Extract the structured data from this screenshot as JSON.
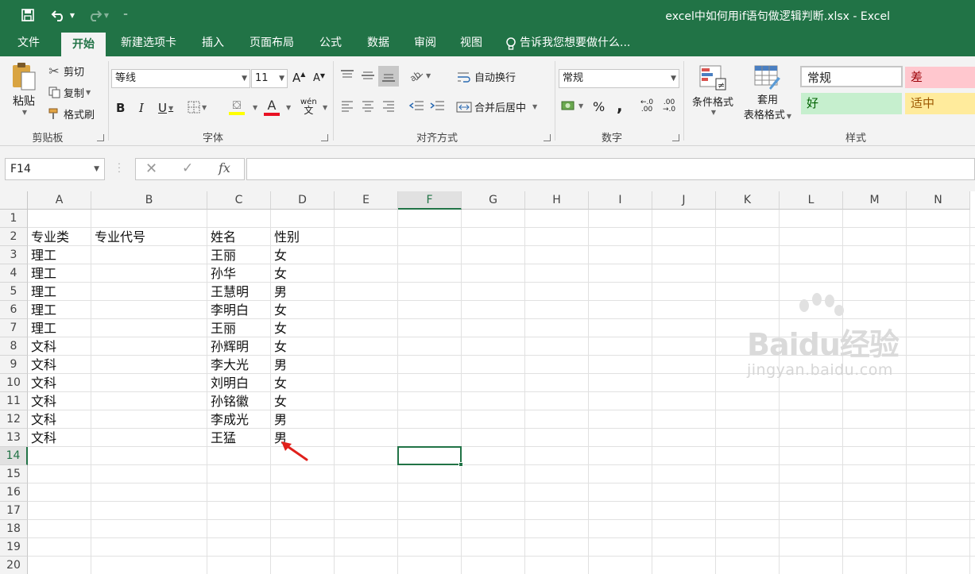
{
  "window": {
    "title": "excel中如何用if语句做逻辑判断.xlsx - Excel"
  },
  "quick_access": {
    "customize": "⁼"
  },
  "ribbon_tabs": [
    {
      "label": "文件"
    },
    {
      "label": "开始"
    },
    {
      "label": "新建选项卡"
    },
    {
      "label": "插入"
    },
    {
      "label": "页面布局"
    },
    {
      "label": "公式"
    },
    {
      "label": "数据"
    },
    {
      "label": "审阅"
    },
    {
      "label": "视图"
    },
    {
      "label": "告诉我您想要做什么..."
    }
  ],
  "clipboard": {
    "paste": "粘贴",
    "cut": "剪切",
    "copy": "复制",
    "format_painter": "格式刷",
    "group": "剪贴板"
  },
  "font": {
    "name": "等线",
    "size": "11",
    "bold": "B",
    "italic": "I",
    "underline": "U",
    "font_color_glyph": "A",
    "phonetic": "wén",
    "group": "字体",
    "grow": "A",
    "shrink": "A"
  },
  "alignment": {
    "wrap": "自动换行",
    "merge": "合并后居中",
    "group": "对齐方式"
  },
  "number": {
    "format": "常规",
    "percent": "%",
    "comma": ",",
    "inc_decimal": "←.0\n.00",
    "dec_decimal": ".00\n→.0",
    "group": "数字"
  },
  "styles": {
    "conditional": "条件格式",
    "table_line1": "套用",
    "table_line2": "表格格式",
    "cells": [
      {
        "label": "常规",
        "bg": "#ffffff",
        "fg": "#222222"
      },
      {
        "label": "差",
        "bg": "#ffc7ce",
        "fg": "#9c0006"
      },
      {
        "label": "好",
        "bg": "#c6efce",
        "fg": "#006100"
      },
      {
        "label": "适中",
        "bg": "#ffeb9c",
        "fg": "#9c5700"
      }
    ],
    "group": "样式"
  },
  "formula_bar": {
    "name_box": "F14",
    "fx": "fx",
    "value": ""
  },
  "sheet": {
    "columns": [
      "A",
      "B",
      "C",
      "D",
      "E",
      "F",
      "G",
      "H",
      "I",
      "J",
      "K",
      "L",
      "M",
      "N"
    ],
    "rows": [
      "1",
      "2",
      "3",
      "4",
      "5",
      "6",
      "7",
      "8",
      "9",
      "10",
      "11",
      "12",
      "13",
      "14",
      "15",
      "16",
      "17",
      "18",
      "19",
      "20"
    ],
    "selected_cell": "F14",
    "data": [
      [
        "",
        "",
        "",
        ""
      ],
      [
        "专业类",
        "专业代号",
        "姓名",
        "性别"
      ],
      [
        "理工",
        "",
        "王丽",
        "女"
      ],
      [
        "理工",
        "",
        "孙华",
        "女"
      ],
      [
        "理工",
        "",
        "王慧明",
        "男"
      ],
      [
        "理工",
        "",
        "李明白",
        "女"
      ],
      [
        "理工",
        "",
        "王丽",
        "女"
      ],
      [
        "文科",
        "",
        "孙辉明",
        "女"
      ],
      [
        "文科",
        "",
        "李大光",
        "男"
      ],
      [
        "文科",
        "",
        "刘明白",
        "女"
      ],
      [
        "文科",
        "",
        "孙铭徽",
        "女"
      ],
      [
        "文科",
        "",
        "李成光",
        "男"
      ],
      [
        "文科",
        "",
        "王猛",
        "男"
      ]
    ]
  },
  "watermark": {
    "logo": "Baidu经验",
    "url": "jingyan.baidu.com"
  },
  "colors": {
    "accent": "#217346",
    "annotation_arrow": "#e0201b"
  }
}
